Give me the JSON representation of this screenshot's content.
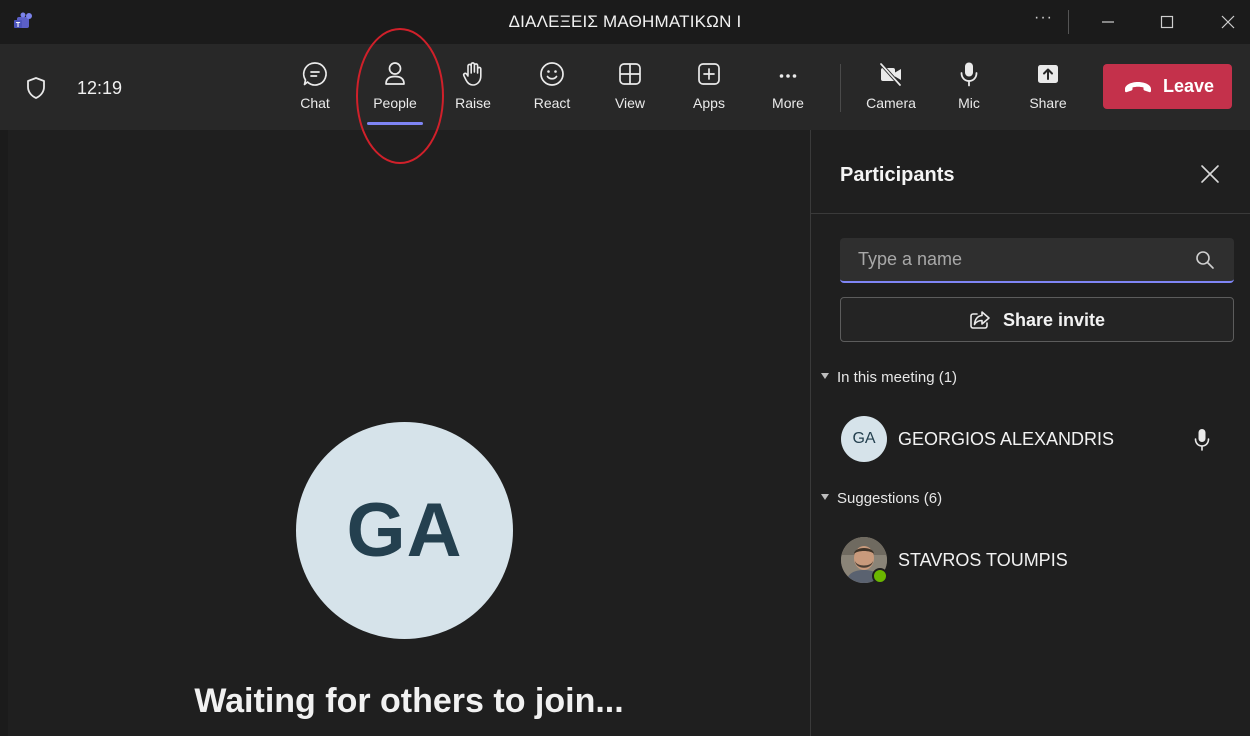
{
  "window": {
    "title": "ΔΙΑΛΕΞΕΙΣ ΜΑΘΗΜΑΤΙΚΩΝ Ι",
    "more_label": "···"
  },
  "toolbar": {
    "time": "12:19",
    "buttons": [
      {
        "label": "Chat",
        "icon": "chat-icon"
      },
      {
        "label": "People",
        "icon": "people-icon",
        "active": true
      },
      {
        "label": "Raise",
        "icon": "raise-hand-icon"
      },
      {
        "label": "React",
        "icon": "react-smiley-icon"
      },
      {
        "label": "View",
        "icon": "view-grid-icon"
      },
      {
        "label": "Apps",
        "icon": "apps-plus-icon"
      },
      {
        "label": "More",
        "icon": "more-dots-icon"
      },
      {
        "label": "Camera",
        "icon": "camera-off-icon"
      },
      {
        "label": "Mic",
        "icon": "mic-icon"
      },
      {
        "label": "Share",
        "icon": "share-tray-icon"
      }
    ],
    "leave_label": "Leave",
    "colors": {
      "leave": "#c4314b",
      "accent": "#7f85f5"
    }
  },
  "stage": {
    "avatar_initials": "GA",
    "waiting_text": "Waiting for others to join..."
  },
  "panel": {
    "title": "Participants",
    "search_placeholder": "Type a name",
    "share_invite_label": "Share invite",
    "in_meeting_label": "In this meeting (1)",
    "suggestions_label": "Suggestions (6)",
    "participants": [
      {
        "initials": "GA",
        "name": "GEORGIOS ALEXANDRIS",
        "mic": true
      }
    ],
    "suggestions": [
      {
        "name": "STAVROS TOUMPIS",
        "status": "available"
      }
    ]
  }
}
